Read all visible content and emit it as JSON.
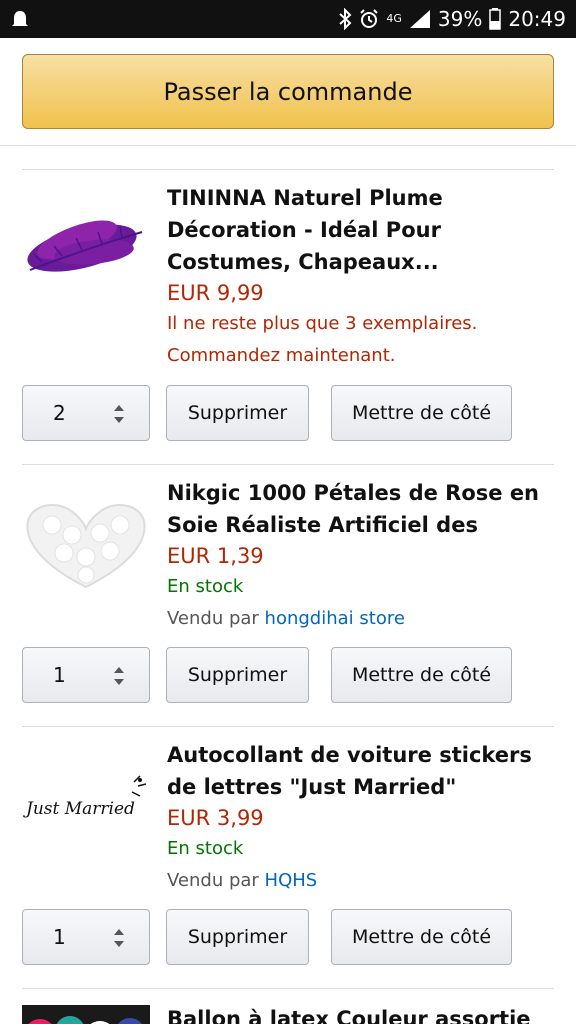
{
  "status_bar": {
    "network": "4G",
    "battery_percent": "39%",
    "time": "20:49"
  },
  "checkout_button_label": "Passer la commande",
  "items": [
    {
      "title": "TININNA Naturel Plume Décoration - Idéal Pour Costumes, Chapeaux...",
      "price": "EUR 9,99",
      "stock_warning_line1": "Il ne reste plus que 3 exemplaires.",
      "stock_warning_line2": "Commandez maintenant.",
      "quantity": "2",
      "delete_label": "Supprimer",
      "save_label": "Mettre de côté",
      "image_icon": "purple-feather-icon"
    },
    {
      "title": "Nikgic 1000 Pétales de Rose en Soie Réaliste Artificiel des Péta...",
      "price": "EUR 1,39",
      "stock": "En stock",
      "seller_prefix": "Vendu par",
      "seller_name": "hongdihai store",
      "quantity": "1",
      "delete_label": "Supprimer",
      "save_label": "Mettre de côté",
      "image_icon": "white-rose-petals-icon"
    },
    {
      "title": "Autocollant de voiture stickers de lettres \"Just Married\" Access...",
      "price": "EUR 3,99",
      "stock": "En stock",
      "seller_prefix": "Vendu par",
      "seller_name": "HQHS",
      "quantity": "1",
      "delete_label": "Supprimer",
      "save_label": "Mettre de côté",
      "image_icon": "just-married-sticker-icon",
      "image_text": "Just Married"
    },
    {
      "title": "Ballon à latex Couleur assortie",
      "image_icon": "balloons-icon"
    }
  ],
  "colors": {
    "price": "#b12704",
    "in_stock": "#007600",
    "link": "#0066c0",
    "checkout_button": "#f0c14b"
  }
}
